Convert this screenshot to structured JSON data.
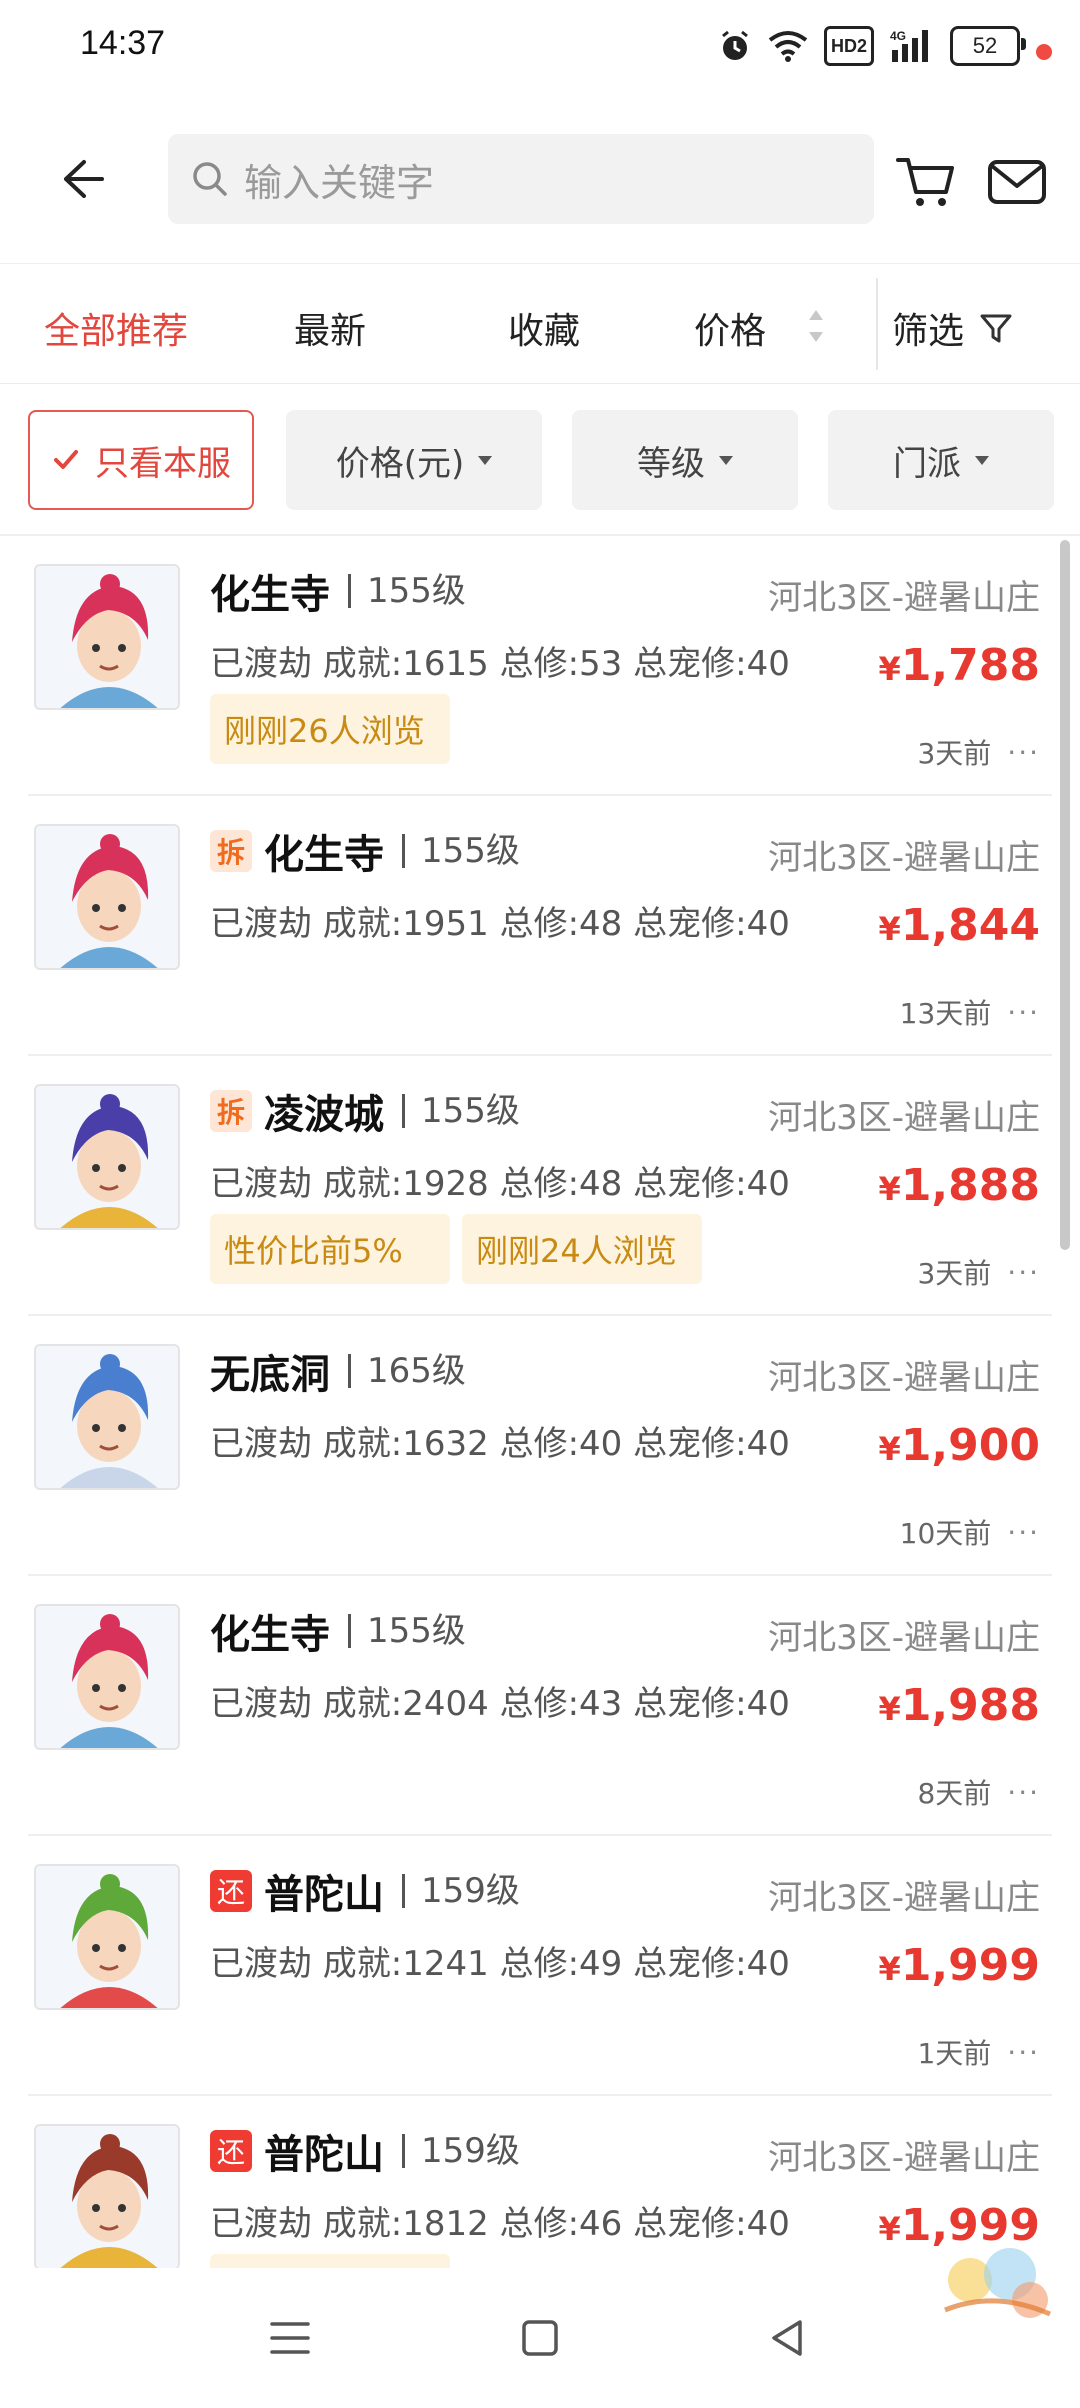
{
  "status_bar": {
    "time": "14:37",
    "battery": "52",
    "hd_label": "HD2",
    "network_label": "4G"
  },
  "header": {
    "search_placeholder": "输入关键字"
  },
  "tabs": [
    {
      "label": "全部推荐",
      "active": true
    },
    {
      "label": "最新",
      "active": false
    },
    {
      "label": "收藏",
      "active": false
    },
    {
      "label": "价格",
      "active": false
    }
  ],
  "filter_label": "筛选",
  "chips": {
    "only_server": "只看本服",
    "price": "价格(元)",
    "level": "等级",
    "school": "门派"
  },
  "listings": [
    {
      "badge": "",
      "badge_type": "",
      "school": "化生寺",
      "level": "155级",
      "server": "河北3区-避暑山庄",
      "stats": "已渡劫 成就:1615 总修:53 总宠修:40",
      "price": "1,788",
      "tags": [
        "刚刚26人浏览"
      ],
      "time": "3天前",
      "avatar_hair": "#d8325a",
      "avatar_accent": "#6aa8d8"
    },
    {
      "badge": "拆",
      "badge_type": "chai",
      "school": "化生寺",
      "level": "155级",
      "server": "河北3区-避暑山庄",
      "stats": "已渡劫 成就:1951 总修:48 总宠修:40",
      "price": "1,844",
      "tags": [],
      "time": "13天前",
      "avatar_hair": "#d8325a",
      "avatar_accent": "#6aa8d8"
    },
    {
      "badge": "拆",
      "badge_type": "chai",
      "school": "凌波城",
      "level": "155级",
      "server": "河北3区-避暑山庄",
      "stats": "已渡劫 成就:1928 总修:48 总宠修:40",
      "price": "1,888",
      "tags": [
        "性价比前5%",
        "刚刚24人浏览"
      ],
      "time": "3天前",
      "avatar_hair": "#4a3ea8",
      "avatar_accent": "#e8b43a"
    },
    {
      "badge": "",
      "badge_type": "",
      "school": "无底洞",
      "level": "165级",
      "server": "河北3区-避暑山庄",
      "stats": "已渡劫 成就:1632 总修:40 总宠修:40",
      "price": "1,900",
      "tags": [],
      "time": "10天前",
      "avatar_hair": "#4a7fd0",
      "avatar_accent": "#c9d6ea"
    },
    {
      "badge": "",
      "badge_type": "",
      "school": "化生寺",
      "level": "155级",
      "server": "河北3区-避暑山庄",
      "stats": "已渡劫 成就:2404 总修:43 总宠修:40",
      "price": "1,988",
      "tags": [],
      "time": "8天前",
      "avatar_hair": "#d8325a",
      "avatar_accent": "#6aa8d8"
    },
    {
      "badge": "还",
      "badge_type": "huan",
      "school": "普陀山",
      "level": "159级",
      "server": "河北3区-避暑山庄",
      "stats": "已渡劫 成就:1241 总修:49 总宠修:40",
      "price": "1,999",
      "tags": [],
      "time": "1天前",
      "avatar_hair": "#5fa83a",
      "avatar_accent": "#e34a4a"
    },
    {
      "badge": "还",
      "badge_type": "huan",
      "school": "普陀山",
      "level": "159级",
      "server": "河北3区-避暑山庄",
      "stats": "已渡劫 成就:1812 总修:46 总宠修:40",
      "price": "1,999",
      "tags": [
        ""
      ],
      "time": "",
      "avatar_hair": "#9a3a2a",
      "avatar_accent": "#e8b43a"
    }
  ],
  "colors": {
    "accent": "#e2463c",
    "price": "#e7392f",
    "tag_bg": "#fdf3de",
    "tag_text": "#c98a12"
  }
}
